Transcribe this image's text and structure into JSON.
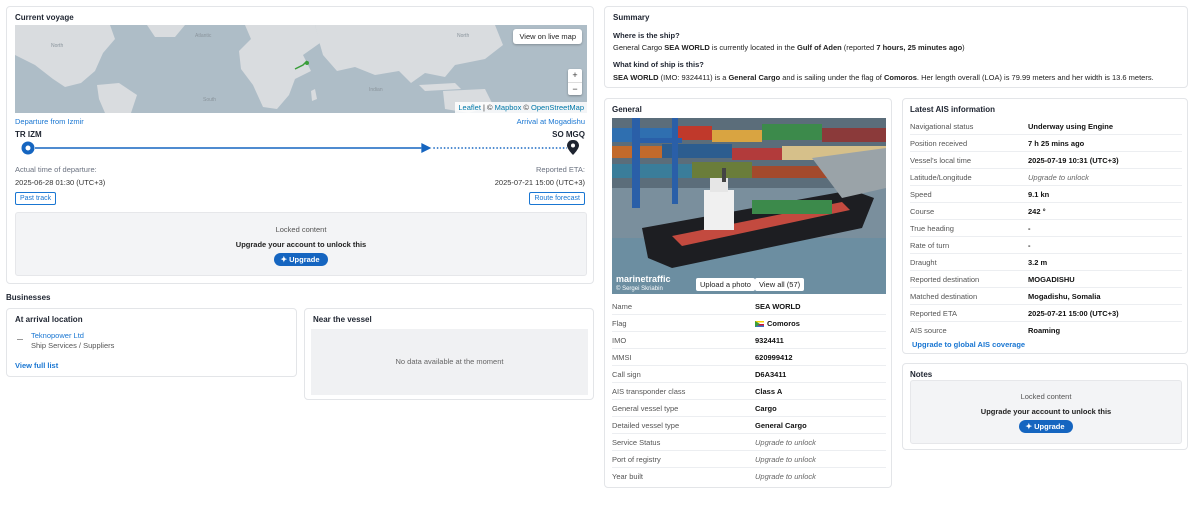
{
  "voyage": {
    "title": "Current voyage",
    "map_button": "View on live map",
    "zoom_in": "+",
    "zoom_out": "−",
    "attribution": {
      "leaflet": "Leaflet",
      "sep": " | © ",
      "mapbox": "Mapbox",
      "sep2": " © ",
      "osm": "OpenStreetMap"
    },
    "map_labels": [
      "North Atlantic Ocean",
      "North Pacific Ocean",
      "Indian Ocean",
      "South Atlantic Ocean",
      "South Pacific Ocean"
    ],
    "departure_label": "Departure from Izmir",
    "departure_code": "TR IZM",
    "arrival_label": "Arrival at Mogadishu",
    "arrival_code": "SO MGQ",
    "atd_label": "Actual time of departure:",
    "atd_value": "2025-06-28 01:30 (UTC+3)",
    "eta_label": "Reported ETA:",
    "eta_value": "2025-07-21 15:00 (UTC+3)",
    "past_track": "Past track",
    "route_forecast": "Route forecast",
    "progress": 0.745,
    "locked": {
      "line1": "Locked content",
      "line2": "Upgrade your account to unlock this",
      "button": "Upgrade"
    }
  },
  "businesses": {
    "heading": "Businesses",
    "arrival": {
      "title": "At arrival location",
      "item_name": "Teknopower Ltd",
      "item_category": "Ship Services / Suppliers",
      "view_full": "View full list"
    },
    "near": {
      "title": "Near the vessel",
      "empty": "No data available at the moment"
    }
  },
  "summary": {
    "title": "Summary",
    "q1": "Where is the ship?",
    "a1": [
      "General Cargo ",
      "SEA WORLD",
      " is currently located in the ",
      "Gulf of Aden",
      " (reported ",
      "7 hours, 25 minutes ago",
      ")"
    ],
    "q2": "What kind of ship is this?",
    "a2": [
      "SEA WORLD",
      " (IMO: 9324411) is a ",
      "General Cargo",
      " and is sailing under the flag of ",
      "Comoros",
      ". Her length overall (LOA) is 79.99 meters and her width is 13.6 meters."
    ]
  },
  "general": {
    "title": "General",
    "watermark": "marinetraffic",
    "photo_credit": "© Sergei Skriabin",
    "upload_photo": "Upload a photo",
    "view_all": "View all (57)",
    "rows": [
      {
        "k": "Name",
        "v": "SEA WORLD"
      },
      {
        "k": "Flag",
        "v": "Comoros"
      },
      {
        "k": "IMO",
        "v": "9324411"
      },
      {
        "k": "MMSI",
        "v": "620999412"
      },
      {
        "k": "Call sign",
        "v": "D6A3411"
      },
      {
        "k": "AIS transponder class",
        "v": "Class A"
      },
      {
        "k": "General vessel type",
        "v": "Cargo"
      },
      {
        "k": "Detailed vessel type",
        "v": "General Cargo"
      },
      {
        "k": "Service Status",
        "v": "Upgrade to unlock"
      },
      {
        "k": "Port of registry",
        "v": "Upgrade to unlock"
      },
      {
        "k": "Year built",
        "v": "Upgrade to unlock"
      }
    ]
  },
  "ais": {
    "title": "Latest AIS information",
    "rows": [
      {
        "k": "Navigational status",
        "v": "Underway using Engine"
      },
      {
        "k": "Position received",
        "v": "7 h 25 mins ago"
      },
      {
        "k": "Vessel's local time",
        "v": "2025-07-19 10:31 (UTC+3)"
      },
      {
        "k": "Latitude/Longitude",
        "v": "Upgrade to unlock"
      },
      {
        "k": "Speed",
        "v": "9.1 kn"
      },
      {
        "k": "Course",
        "v": "242 °"
      },
      {
        "k": "True heading",
        "v": "-"
      },
      {
        "k": "Rate of turn",
        "v": "-"
      },
      {
        "k": "Draught",
        "v": "3.2 m"
      },
      {
        "k": "Reported destination",
        "v": "MOGADISHU"
      },
      {
        "k": "Matched destination",
        "v": "Mogadishu, Somalia"
      },
      {
        "k": "Reported ETA",
        "v": "2025-07-21 15:00 (UTC+3)"
      },
      {
        "k": "AIS source",
        "v": "Roaming"
      }
    ],
    "upgrade_link": "Upgrade to global AIS coverage"
  },
  "notes": {
    "title": "Notes",
    "locked": {
      "line1": "Locked content",
      "line2": "Upgrade your account to unlock this",
      "button": "Upgrade"
    }
  },
  "colors": {
    "accent": "#1976d2",
    "upgrade": "#1565c0",
    "route": "#1565c0"
  }
}
